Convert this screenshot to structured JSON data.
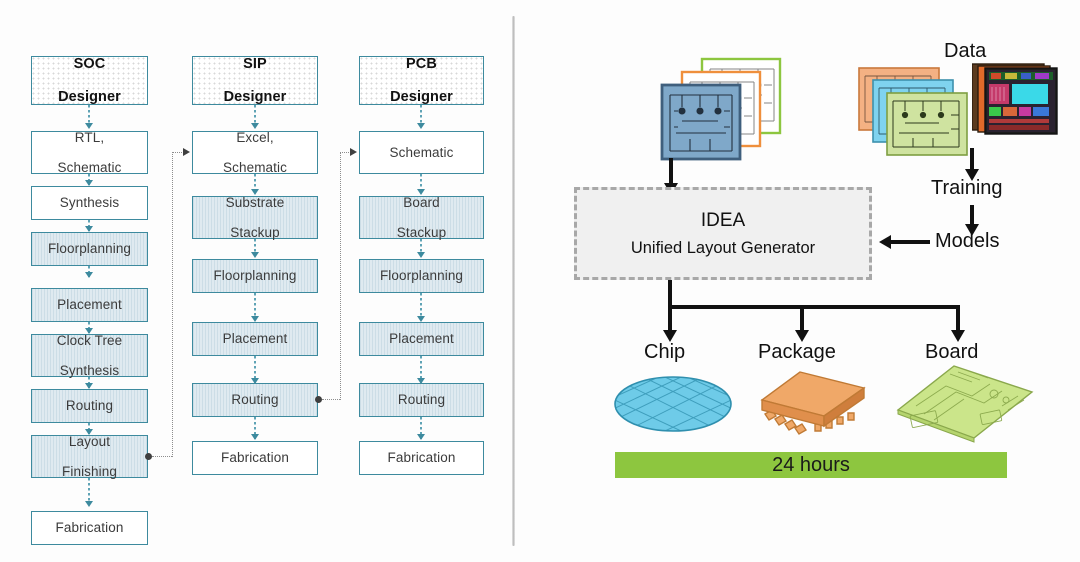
{
  "left_panel": {
    "columns": [
      {
        "id": "soc",
        "header": "SOC\nDesigner",
        "header_line1": "SOC",
        "header_line2": "Designer",
        "steps": [
          {
            "label": "RTL,\nSchematic",
            "line1": "RTL,",
            "line2": "Schematic",
            "style": "plain"
          },
          {
            "label": "Synthesis",
            "line1": "Synthesis",
            "line2": "",
            "style": "plain"
          },
          {
            "label": "Floorplanning",
            "line1": "Floorplanning",
            "line2": "",
            "style": "fill"
          },
          {
            "label": "Placement",
            "line1": "Placement",
            "line2": "",
            "style": "fill"
          },
          {
            "label": "Clock Tree\nSynthesis",
            "line1": "Clock Tree",
            "line2": "Synthesis",
            "style": "fill"
          },
          {
            "label": "Routing",
            "line1": "Routing",
            "line2": "",
            "style": "fill"
          },
          {
            "label": "Layout\nFinishing",
            "line1": "Layout",
            "line2": "Finishing",
            "style": "fill"
          },
          {
            "label": "Fabrication",
            "line1": "Fabrication",
            "line2": "",
            "style": "plain"
          }
        ]
      },
      {
        "id": "sip",
        "header": "SIP\nDesigner",
        "header_line1": "SIP",
        "header_line2": "Designer",
        "steps": [
          {
            "label": "Excel,\nSchematic",
            "line1": "Excel,",
            "line2": "Schematic",
            "style": "plain"
          },
          {
            "label": "Substrate\nStackup",
            "line1": "Substrate",
            "line2": "Stackup",
            "style": "fill"
          },
          {
            "label": "Floorplanning",
            "line1": "Floorplanning",
            "line2": "",
            "style": "fill"
          },
          {
            "label": "Placement",
            "line1": "Placement",
            "line2": "",
            "style": "fill"
          },
          {
            "label": "Routing",
            "line1": "Routing",
            "line2": "",
            "style": "fill"
          },
          {
            "label": "Fabrication",
            "line1": "Fabrication",
            "line2": "",
            "style": "plain"
          }
        ]
      },
      {
        "id": "pcb",
        "header": "PCB\nDesigner",
        "header_line1": "PCB",
        "header_line2": "Designer",
        "steps": [
          {
            "label": "Schematic",
            "line1": "Schematic",
            "line2": "",
            "style": "plain"
          },
          {
            "label": "Board\nStackup",
            "line1": "Board",
            "line2": "Stackup",
            "style": "fill"
          },
          {
            "label": "Floorplanning",
            "line1": "Floorplanning",
            "line2": "",
            "style": "fill"
          },
          {
            "label": "Placement",
            "line1": "Placement",
            "line2": "",
            "style": "fill"
          },
          {
            "label": "Routing",
            "line1": "Routing",
            "line2": "",
            "style": "fill"
          },
          {
            "label": "Fabrication",
            "line1": "Fabrication",
            "line2": "",
            "style": "plain"
          }
        ]
      }
    ]
  },
  "right_panel": {
    "data_label": "Data",
    "training_label": "Training",
    "models_label": "Models",
    "idea_title": "IDEA",
    "idea_subtitle": "Unified Layout Generator",
    "outputs": [
      "Chip",
      "Package",
      "Board"
    ],
    "output_chip": "Chip",
    "output_package": "Package",
    "output_board": "Board",
    "hours_label": "24 hours"
  },
  "colors": {
    "box_border": "#3d8a9e",
    "box_fill": "#d5e4ec",
    "connector": "#5fa3b5",
    "feedback": "#8d8d8d",
    "idea_fill": "#f0f0f0",
    "idea_border": "#a8a8a8",
    "hours_bar": "#8dc63f",
    "wafer": "#6ecbe8",
    "package": "#f0a868",
    "board": "#cbe58a",
    "divider": "#b6b6b6",
    "schematic_blue": "#7fa8c9",
    "schematic_orange": "#ef8f3c",
    "schematic_green": "#8dc63f",
    "data_orange": "#f4b183",
    "data_blue": "#7fd3ef",
    "data_green": "#cfe3a0"
  }
}
